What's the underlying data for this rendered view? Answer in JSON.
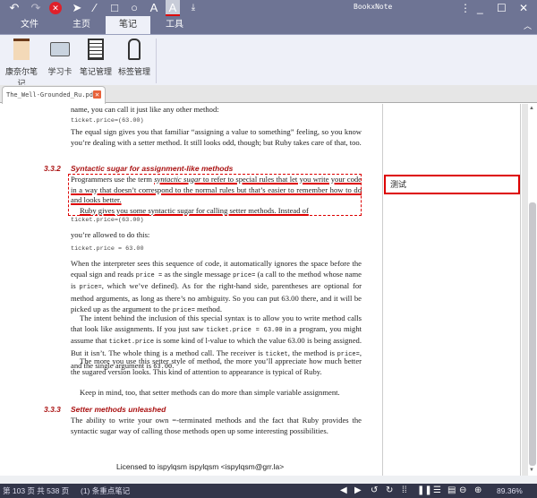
{
  "app": {
    "title": "BookxNote"
  },
  "quick_toolbar": [
    "undo-icon",
    "redo-icon",
    "close-red-icon",
    "pointer-icon",
    "pen-icon",
    "rectangle-icon",
    "circle-icon",
    "text-icon",
    "text-color-icon",
    "insert-icon"
  ],
  "tabs": [
    {
      "label": "文件"
    },
    {
      "label": "主页"
    },
    {
      "label": "笔记",
      "active": true
    },
    {
      "label": "工具"
    }
  ],
  "ribbon": [
    {
      "label": "康奈尔笔记",
      "icon": "notebook-icon"
    },
    {
      "label": "学习卡",
      "icon": "id-card-icon"
    },
    {
      "label": "笔记管理",
      "icon": "notepad-icon"
    },
    {
      "label": "标签管理",
      "icon": "tag-icon"
    }
  ],
  "document_tab": {
    "label": "The_Well-Grounded_Ru.pdf"
  },
  "page": {
    "top_cut": "name, you can call it just like any other method:",
    "code1": "ticket.price=(63.00)",
    "p1": "The equal sign gives you that familiar “assigning a value to something” feeling, so you know you’re dealing with a setter method. It still looks odd, though; but Ruby takes care of that, too.",
    "h1_num": "3.3.2",
    "h1": "Syntactic sugar for assignment-like methods",
    "p2_a": "Programmers use the term ",
    "p2_em": "syntactic sugar",
    "p2_b": " to refer to special rules that let you write your code in a way that doesn’t correspond to the normal rules but that’s easier to remember how to do and looks better.",
    "p3": "Ruby gives you some syntactic sugar for calling setter methods. Instead of",
    "code2": "ticket.price=(63.00)",
    "p4": "you’re allowed to do this:",
    "code3": "ticket.price = 63.00",
    "p5_a": "When the interpreter sees this sequence of code, it automatically ignores the space before the equal sign and reads ",
    "p5_c1": "price =",
    "p5_b": " as the single message ",
    "p5_c2": "price=",
    "p5_c": " (a call to the method whose name is ",
    "p5_c3": "price=",
    "p5_d": ", which we’ve defined). As for the right-hand side, parentheses are optional for method arguments, as long as there’s no ambiguity. So you can put 63.00 there, and it will be picked up as the argument to the ",
    "p5_c4": "price=",
    "p5_e": " method.",
    "p6_a": "The intent behind the inclusion of this special syntax is to allow you to write method calls that look like assignments. If you just saw ",
    "p6_c1": "ticket.price = 63.00",
    "p6_b": " in a program, you might assume that ",
    "p6_c2": "ticket.price",
    "p6_c": " is some kind of l-value to which the value 63.00 is being assigned. But it isn’t. The whole thing is a method call. The receiver is ",
    "p6_c3": "ticket",
    "p6_d": ", the method is ",
    "p6_c4": "price=",
    "p6_e": ", and the single argument is ",
    "p6_c5": "63.00",
    "p6_f": ".",
    "p7": "The more you use this setter style of method, the more you’ll appreciate how much better the sugared version looks. This kind of attention to appearance is typical of Ruby.",
    "p8": "Keep in mind, too, that setter methods can do more than simple variable assignment.",
    "h2_num": "3.3.3",
    "h2": "Setter methods unleashed",
    "p9": "The ability to write your own =-terminated methods and the fact that Ruby provides the syntactic sugar way of calling those methods open up some interesting possibilities.",
    "license": "Licensed to ispylqsm ispylqsm <ispylqsm@grr.la>"
  },
  "note": {
    "text": "测试"
  },
  "status": {
    "page_info": "第 103 页 共 538 页",
    "notes_count": "(1) 条重点笔记",
    "zoom": "89.36%"
  },
  "colors": {
    "toolbar": "#6e7494",
    "highlight": "#dd0000",
    "heading": "#aa1111",
    "statusbar": "#33364a"
  }
}
